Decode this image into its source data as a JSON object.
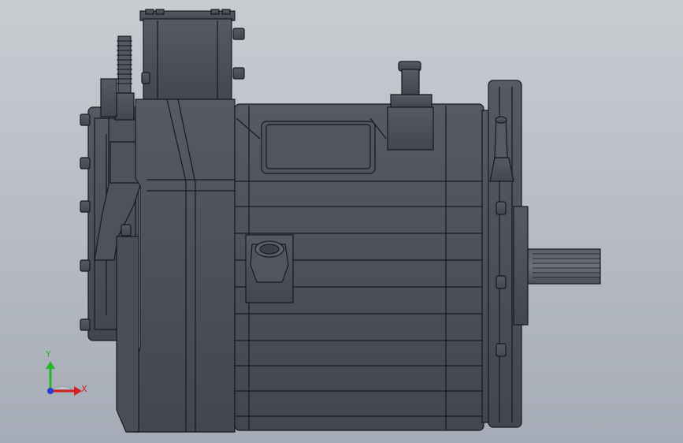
{
  "viewport": {
    "background_top": "#c9ccd1",
    "background_bottom": "#a6acb7"
  },
  "model": {
    "component": "electric-motor-assembly",
    "body_color": "#4b4f59",
    "edge_color": "#17191d",
    "highlight_color": "#6a6f7a"
  },
  "triad": {
    "x_label": "X",
    "y_label": "Y",
    "x_color": "#d42020",
    "y_color": "#27b52a",
    "origin_color": "#2a3ad6"
  }
}
